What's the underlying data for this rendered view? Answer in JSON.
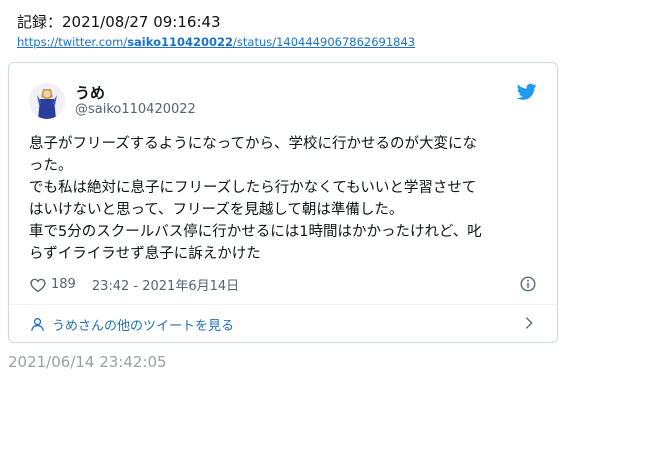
{
  "record": {
    "title": "記録：2021/08/27 09:16:43",
    "link_prefix": "https://twitter.com/",
    "link_user": "saiko110420022",
    "link_suffix": "/status/1404449067862691843"
  },
  "tweet": {
    "display_name": "うめ",
    "handle": "@saiko110420022",
    "text_lines": [
      "息子がフリーズするようになってから、学校に行かせるのが大変にな",
      "った。",
      "でも私は絶対に息子にフリーズしたら行かなくてもいいと学習させて",
      "はいけないと思って、フリーズを見越して朝は準備した。",
      "車で5分のスクールバス停に行かせるには1時間はかかったけれど、叱",
      "らずイライラせず息子に訴えかけた"
    ],
    "like_count": "189",
    "timestamp": "23:42 - 2021年6月14日",
    "more_tweets_label": "うめさんの他のツイートを見る"
  },
  "footer": {
    "saved_timestamp": "2021/06/14 23:42:05"
  },
  "colors": {
    "brand": "#1d9bf0",
    "link": "#1a73c8",
    "muted": "#536471",
    "border": "#cfd9de"
  },
  "icons": [
    "avatar-image",
    "twitter-bird-icon",
    "heart-icon",
    "info-icon",
    "person-icon",
    "chevron-right-icon"
  ]
}
